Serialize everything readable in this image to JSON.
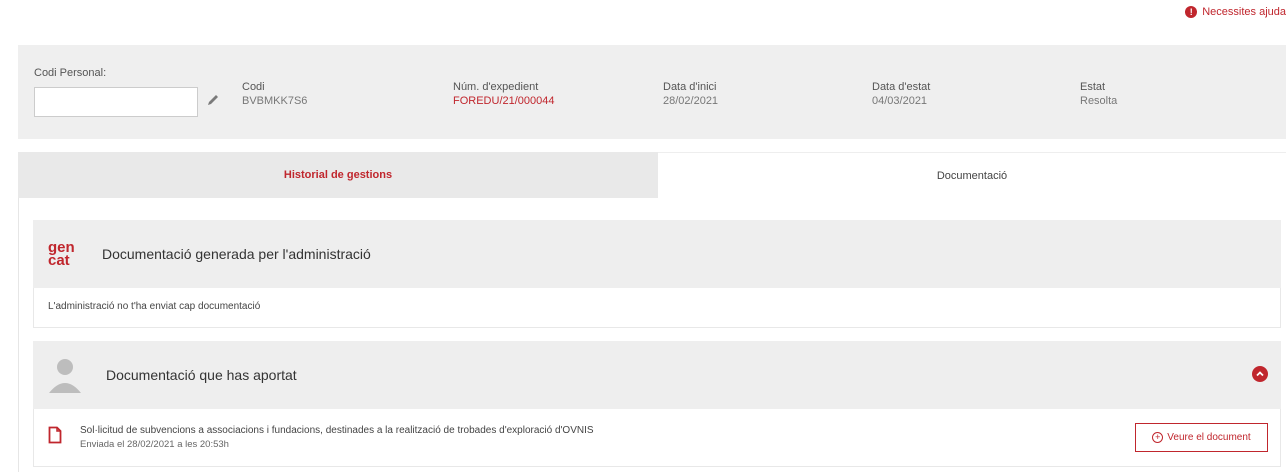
{
  "help": {
    "label": "Necessites ajuda",
    "icon": "exclamation-circle-icon"
  },
  "colors": {
    "accent": "#c0262d",
    "panel": "#efefef",
    "tab_inactive": "#e9e9e9"
  },
  "info": {
    "codi_personal": {
      "label": "Codi Personal:",
      "value": "",
      "placeholder": ""
    },
    "fields": [
      {
        "label": "Codi",
        "value": "BVBMKK7S6"
      },
      {
        "label": "Núm. d'expedient",
        "value": "FOREDU/21/000044"
      },
      {
        "label": "Data d'inici",
        "value": "28/02/2021"
      },
      {
        "label": "Data d'estat",
        "value": "04/03/2021"
      },
      {
        "label": "Estat",
        "value": "Resolta"
      }
    ]
  },
  "tabs": [
    {
      "label": "Historial de gestions"
    },
    {
      "label": "Documentació"
    }
  ],
  "sections": {
    "admin": {
      "logo_top": "gen",
      "logo_bottom": "cat",
      "title": "Documentació generada per l'administració",
      "empty_message": "L'administració no t'ha enviat cap documentació"
    },
    "user": {
      "title": "Documentació que has aportat",
      "documents": [
        {
          "title": "Sol·licitud de subvencions a associacions i fundacions, destinades a la realització de trobades d'exploració d'OVNIS",
          "meta": "Enviada el 28/02/2021 a les 20:53h",
          "button_label": "Veure el document"
        }
      ]
    }
  }
}
